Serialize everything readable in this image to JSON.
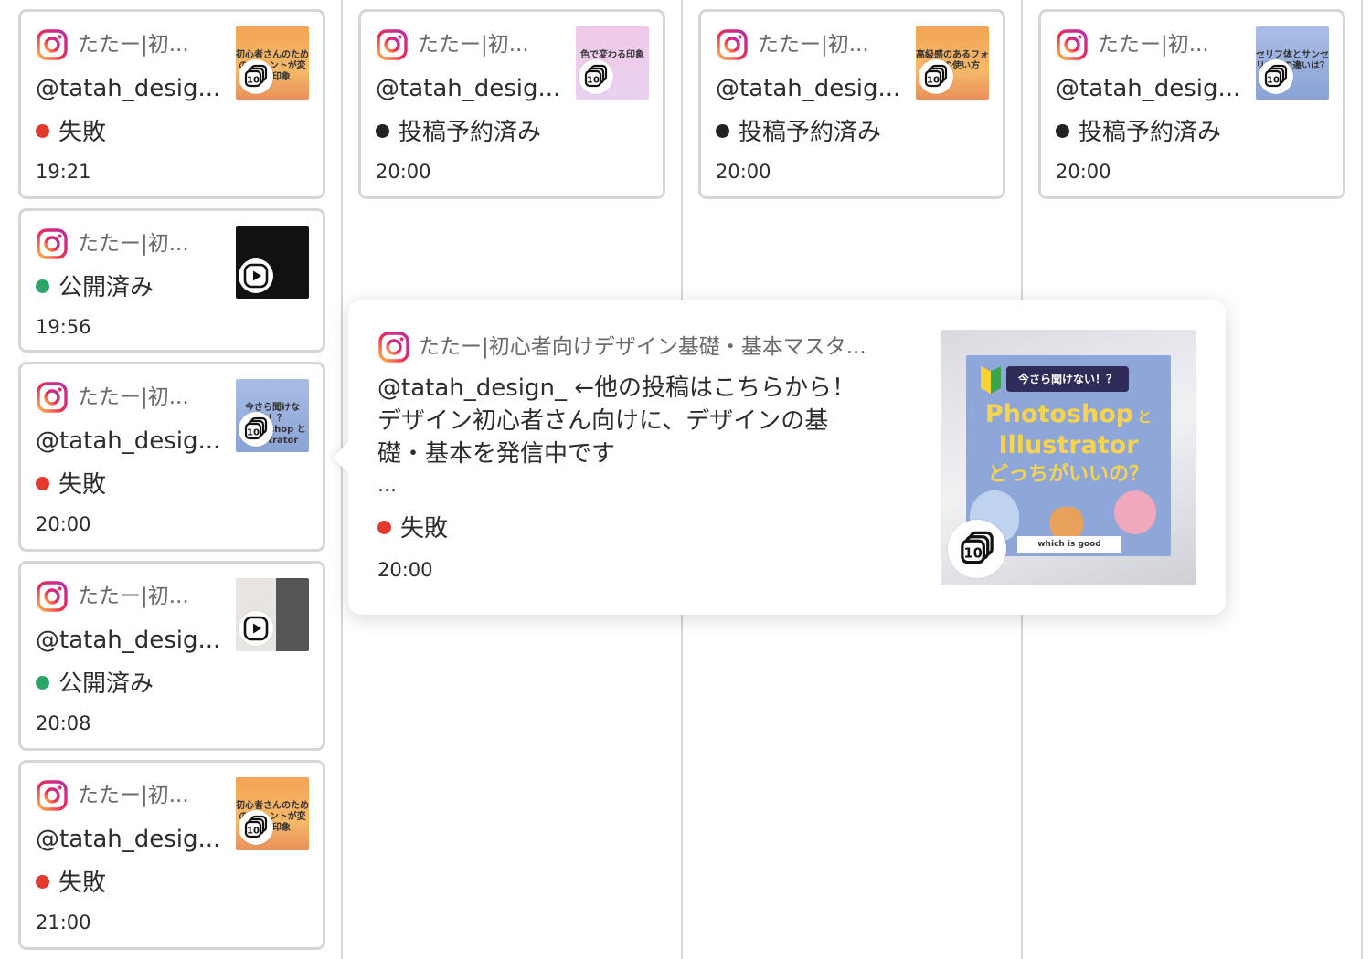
{
  "colors": {
    "failed": "#e5392b",
    "published": "#2aa668",
    "scheduled": "#222222",
    "border": "#d6d6d6"
  },
  "icons": {
    "network": "instagram-icon",
    "carousel": "carousel-stack-icon",
    "video": "play-icon"
  },
  "columns": [
    {
      "cards": [
        {
          "account": "たたー|初...",
          "handle": "@tatah_desig...",
          "status": "失敗",
          "status_color": "failed",
          "time": "19:21",
          "media": "carousel",
          "media_count": "10",
          "thumb_text": "初心者さんのための フォントが変わる印象"
        },
        {
          "account": "たたー|初...",
          "status": "公開済み",
          "status_color": "published",
          "time": "19:56",
          "media": "video"
        },
        {
          "account": "たたー|初...",
          "handle": "@tatah_desig...",
          "status": "失敗",
          "status_color": "failed",
          "time": "20:00",
          "media": "carousel",
          "media_count": "10",
          "thumb_text": "今さら聞けない！？ Photoshop と Illustrator"
        },
        {
          "account": "たたー|初...",
          "handle": "@tatah_desig...",
          "status": "公開済み",
          "status_color": "published",
          "time": "20:08",
          "media": "video"
        },
        {
          "account": "たたー|初...",
          "handle": "@tatah_desig...",
          "status": "失敗",
          "status_color": "failed",
          "time": "21:00",
          "media": "carousel",
          "media_count": "10",
          "thumb_text": "初心者さんのための フォントが変わる印象"
        }
      ]
    },
    {
      "cards": [
        {
          "account": "たたー|初...",
          "handle": "@tatah_desig...",
          "status": "投稿予約済み",
          "status_color": "scheduled",
          "time": "20:00",
          "media": "carousel",
          "media_count": "10",
          "thumb_text": "色で変わる印象"
        }
      ]
    },
    {
      "cards": [
        {
          "account": "たたー|初...",
          "handle": "@tatah_desig...",
          "status": "投稿予約済み",
          "status_color": "scheduled",
          "time": "20:00",
          "media": "carousel",
          "media_count": "10",
          "thumb_text": "高級感のあるフォントの使い方"
        }
      ]
    },
    {
      "cards": [
        {
          "account": "たたー|初...",
          "handle": "@tatah_desig...",
          "status": "投稿予約済み",
          "status_color": "scheduled",
          "time": "20:00",
          "media": "carousel",
          "media_count": "10",
          "thumb_text": "セリフ体とサンセリフ体の違いは？"
        }
      ]
    }
  ],
  "popover": {
    "account": "たたー|初心者向けデザイン基礎・基本マスタ...",
    "caption_line1": "@tatah_design_ ←他の投稿はこちらから！",
    "caption_line2": "デザイン初心者さん向けに、デザインの基",
    "caption_line3": "礎・基本を発信中です",
    "caption_more": "...",
    "status": "失敗",
    "time": "20:00",
    "media_count": "10",
    "image": {
      "banner": "今さら聞けない！？",
      "title1": "Photoshop",
      "title1_suffix": "と",
      "title2": "Illustrator",
      "title3": "どっちがいいの？",
      "footer": "which is good"
    }
  }
}
